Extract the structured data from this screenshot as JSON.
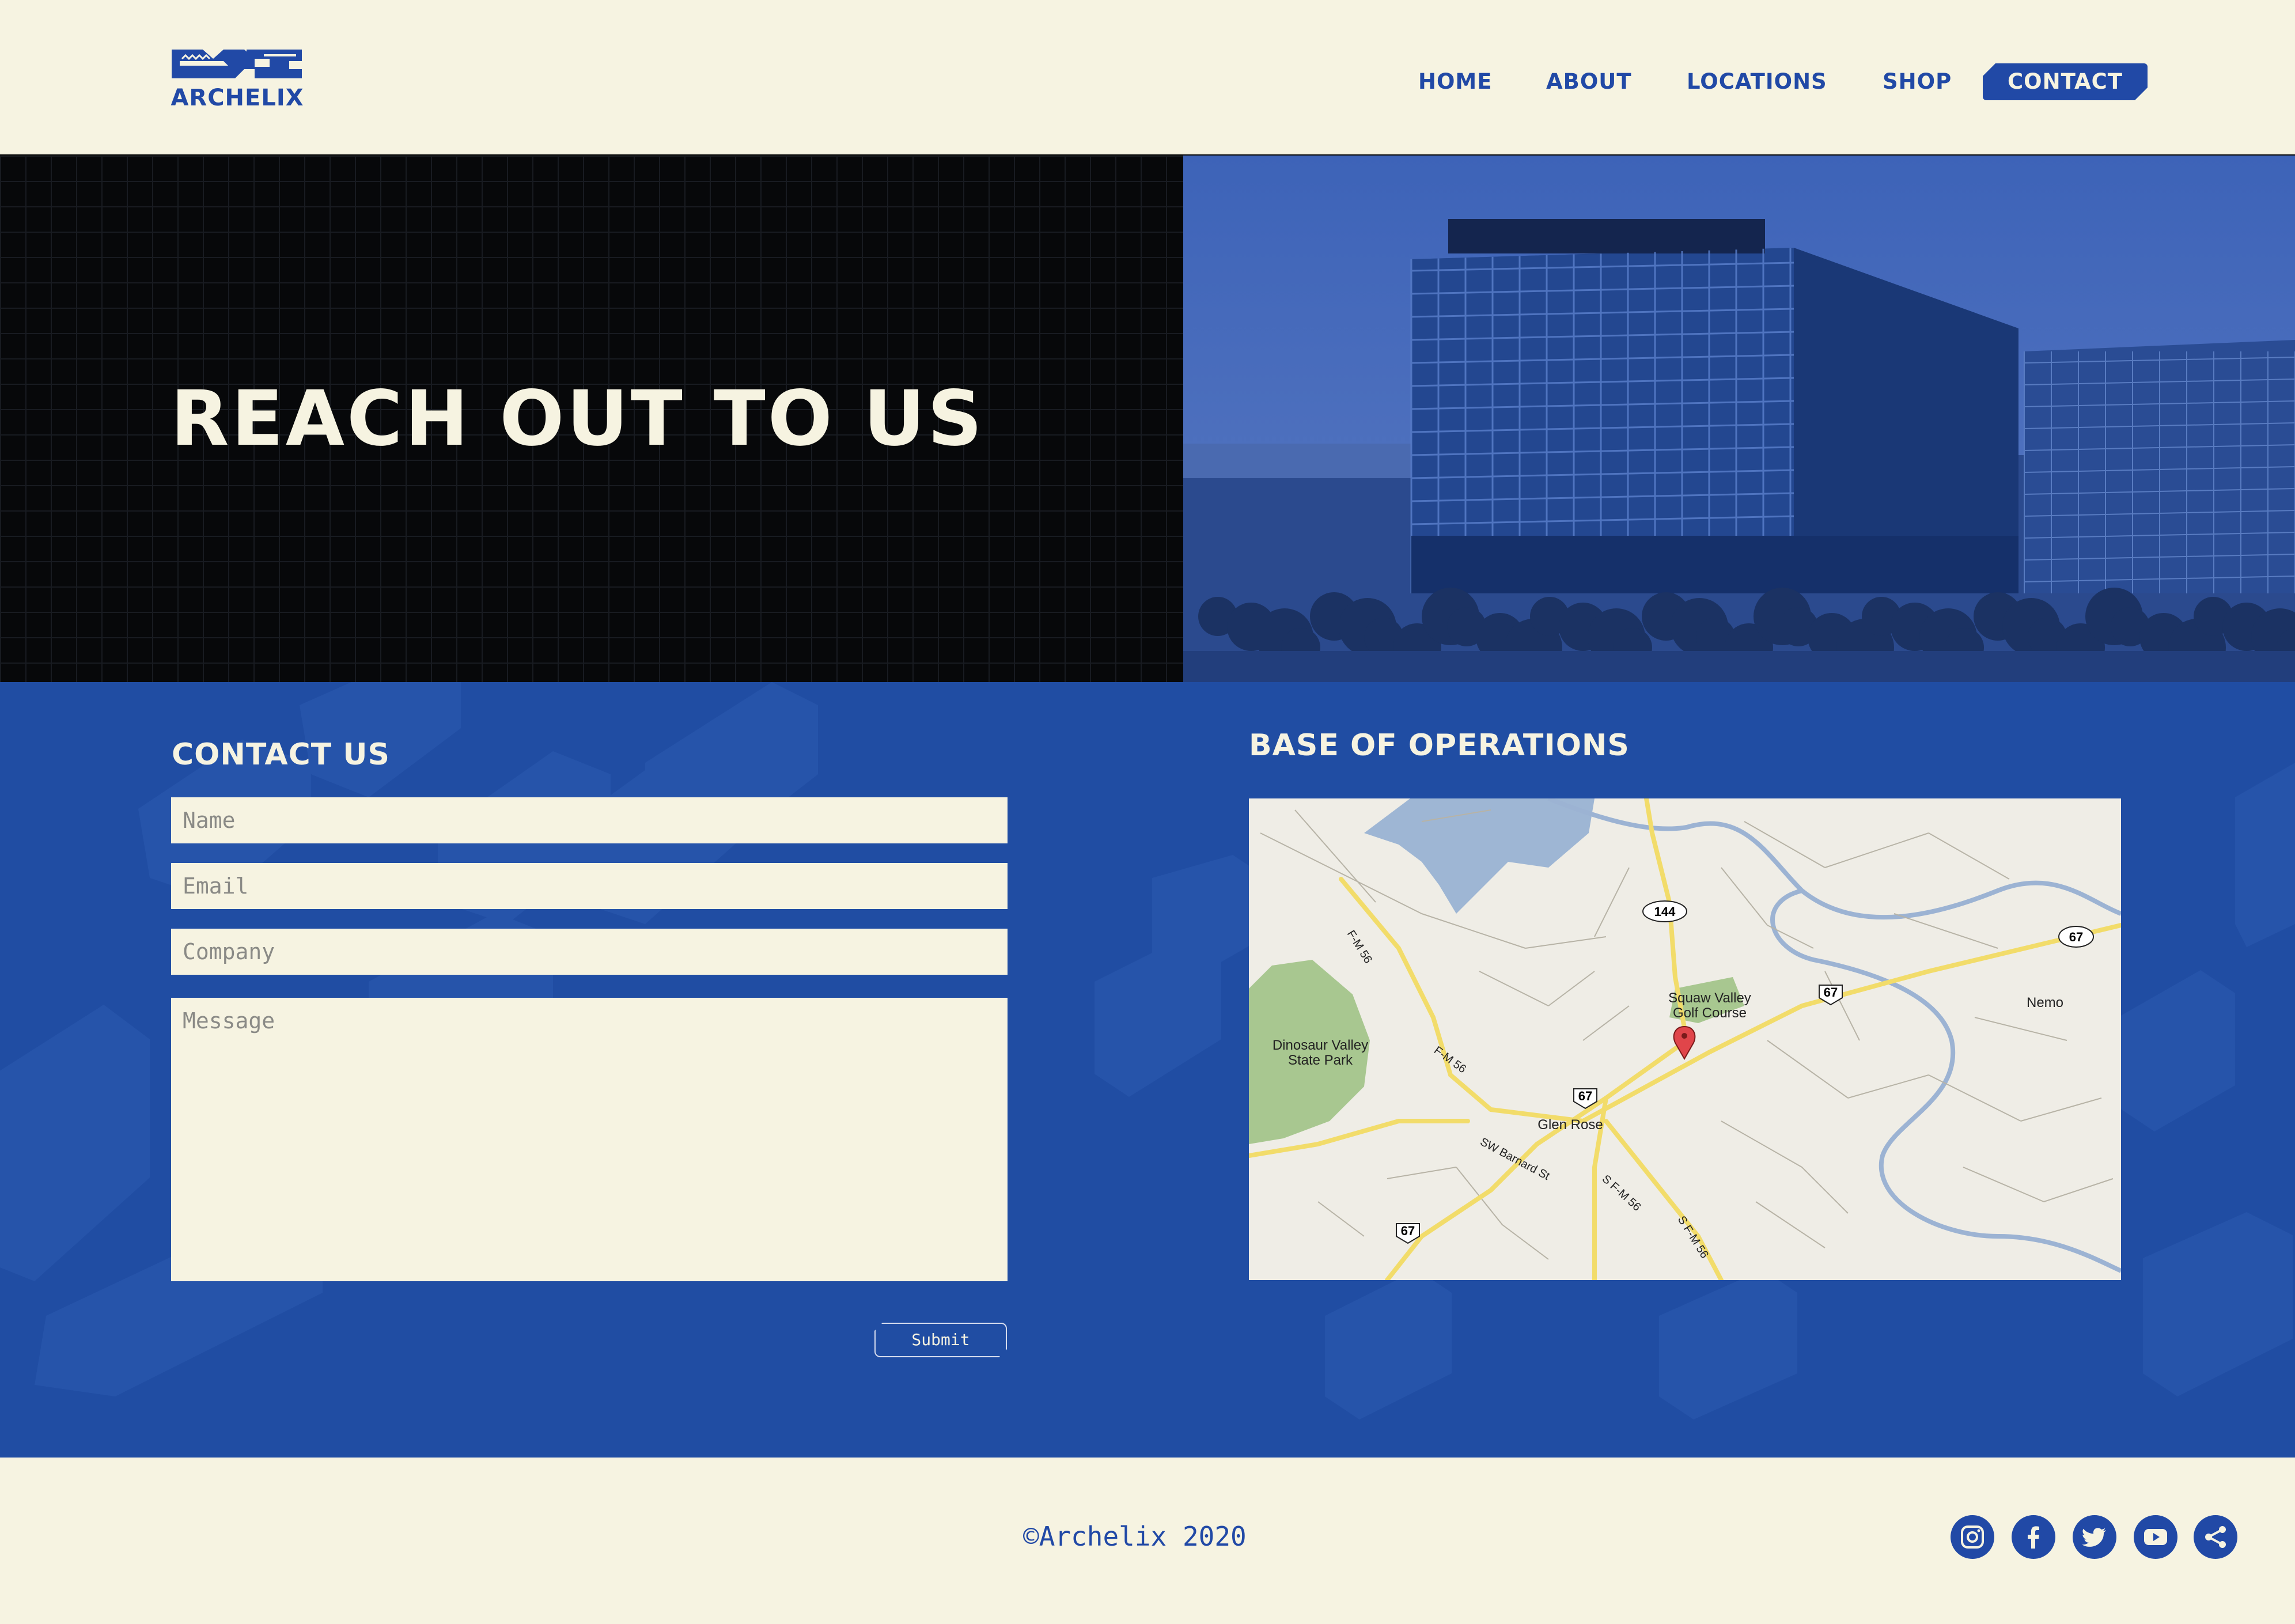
{
  "brand": {
    "name": "ARCHELIX",
    "color": "#2149a6"
  },
  "nav": {
    "items": [
      {
        "label": "HOME"
      },
      {
        "label": "ABOUT"
      },
      {
        "label": "LOCATIONS"
      },
      {
        "label": "SHOP"
      },
      {
        "label": "CONTACT",
        "active": true
      }
    ]
  },
  "hero": {
    "title": "REACH OUT TO US"
  },
  "contact": {
    "heading": "CONTACT US",
    "name_placeholder": "Name",
    "email_placeholder": "Email",
    "company_placeholder": "Company",
    "message_placeholder": "Message",
    "submit_label": "Submit"
  },
  "base": {
    "heading": "BASE OF OPERATIONS",
    "map": {
      "places": [
        "Squaw Valley",
        "Golf Course",
        "Dinosaur Valley",
        "State Park",
        "Glen Rose",
        "Nemo"
      ],
      "roads": [
        "144",
        "67",
        "67",
        "67",
        "67",
        "F-M 56",
        "F-M 56",
        "SW Barnard St",
        "S F-M 56",
        "S F-M 56"
      ]
    }
  },
  "footer": {
    "copyright": "©Archelix 2020",
    "social": [
      "instagram-icon",
      "facebook-icon",
      "twitter-icon",
      "youtube-icon",
      "share-icon"
    ]
  },
  "colors": {
    "cream": "#f6f3e1",
    "blue": "#204da3",
    "black": "#07080a"
  }
}
